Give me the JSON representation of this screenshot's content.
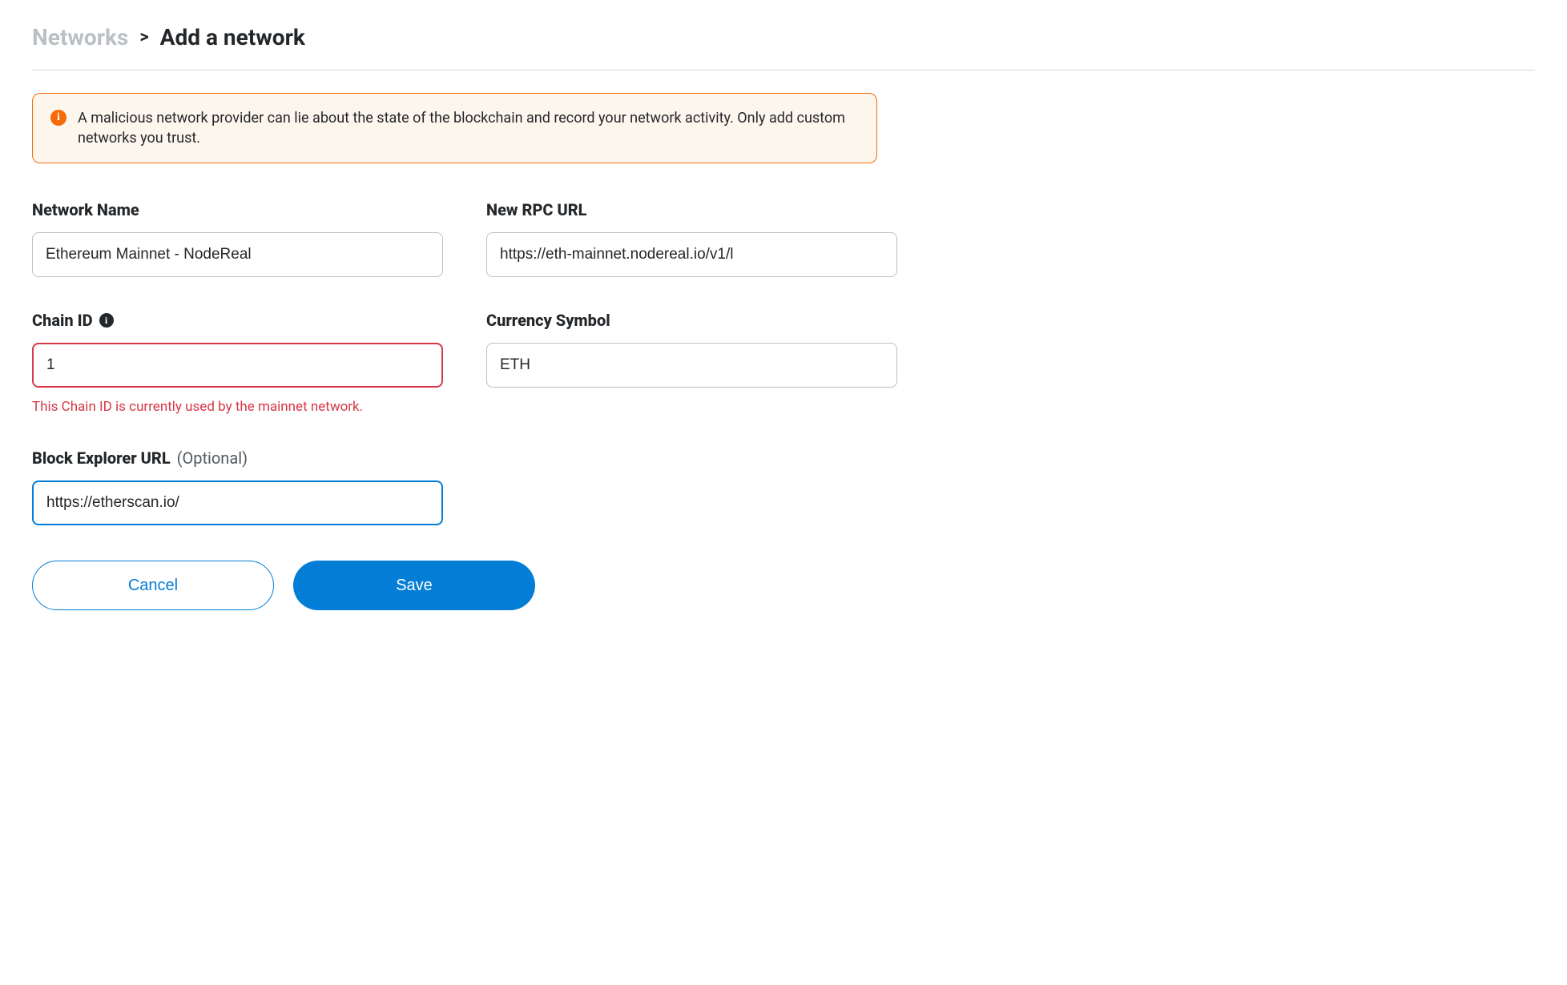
{
  "breadcrumb": {
    "root": "Networks",
    "separator": ">",
    "current": "Add a network"
  },
  "warning": {
    "message": "A malicious network provider can lie about the state of the blockchain and record your network activity. Only add custom networks you trust."
  },
  "fields": {
    "network_name": {
      "label": "Network Name",
      "value": "Ethereum Mainnet - NodeReal"
    },
    "rpc_url": {
      "label": "New RPC URL",
      "value": "https://eth-mainnet.nodereal.io/v1/l"
    },
    "chain_id": {
      "label": "Chain ID",
      "value": "1",
      "error": "This Chain ID is currently used by the mainnet network."
    },
    "currency_symbol": {
      "label": "Currency Symbol",
      "value": "ETH"
    },
    "block_explorer": {
      "label": "Block Explorer URL",
      "optional": "(Optional)",
      "value": "https://etherscan.io/"
    }
  },
  "buttons": {
    "cancel": "Cancel",
    "save": "Save"
  }
}
